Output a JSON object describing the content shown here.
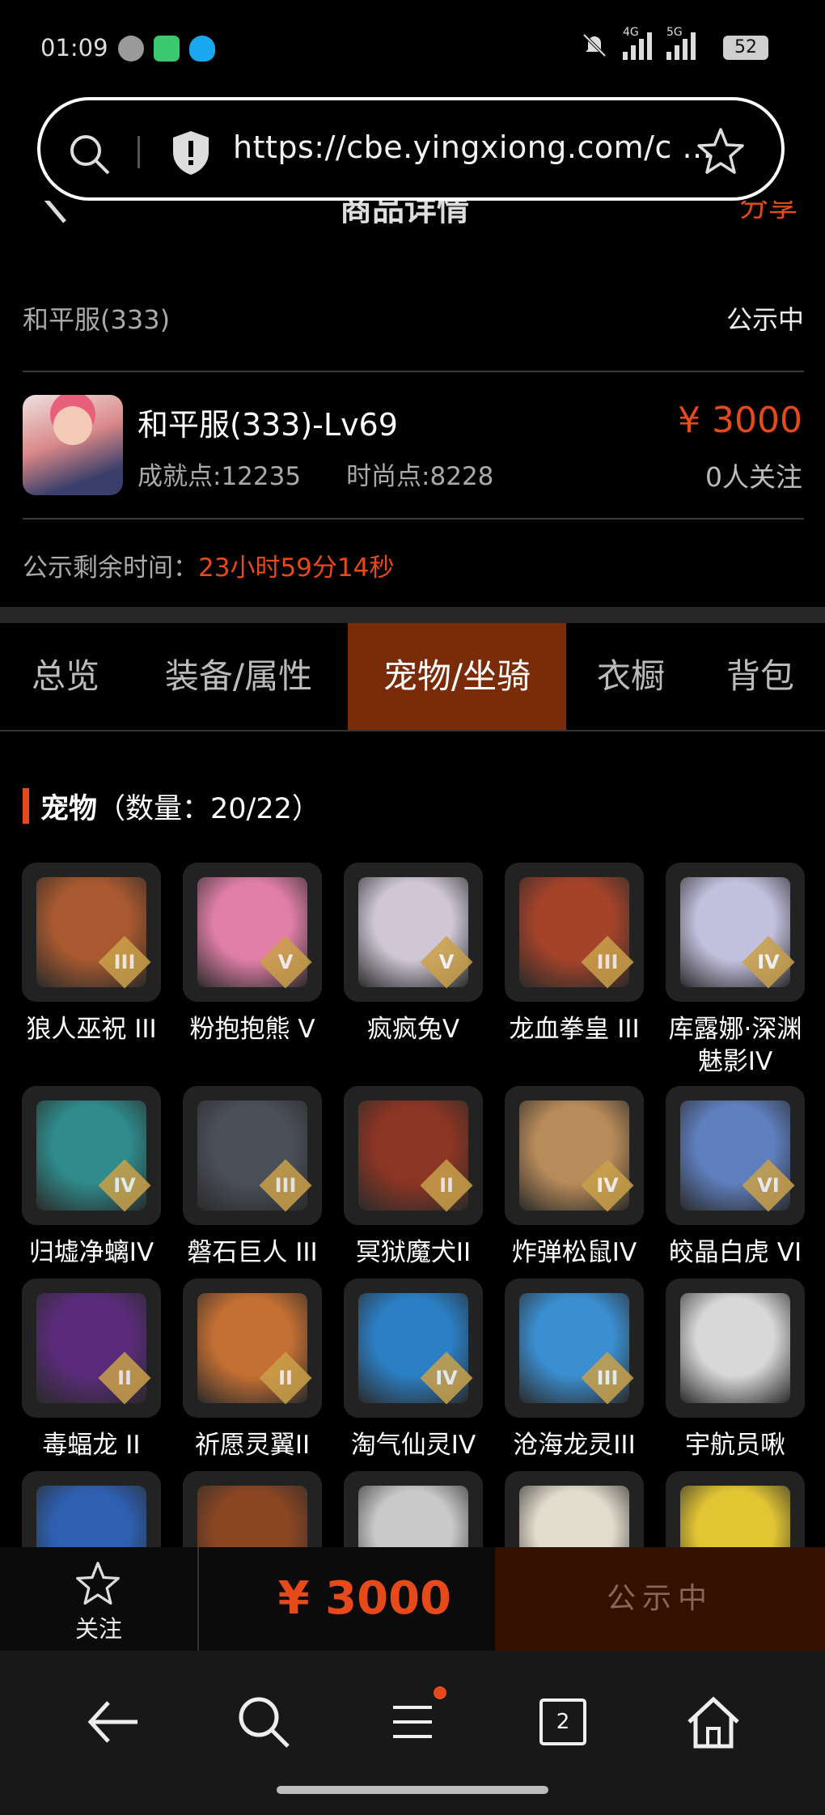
{
  "status_bar": {
    "time": "01:09",
    "net1": "4G",
    "net2": "5G",
    "battery": "52"
  },
  "browser": {
    "url": "https://cbe.yingxiong.com/c ..."
  },
  "header": {
    "title": "商品详情",
    "share": "分享"
  },
  "server": {
    "name": "和平服(333)",
    "status": "公示中"
  },
  "character": {
    "name": "和平服(333)-Lv69",
    "achievement": "成就点:12235",
    "fashion": "时尚点:8228",
    "price": "¥ 3000",
    "followers": "0人关注"
  },
  "remaining": {
    "label": "公示剩余时间：",
    "value": "23小时59分14秒"
  },
  "tabs": [
    "总览",
    "装备/属性",
    "宠物/坐骑",
    "衣橱",
    "背包"
  ],
  "active_tab": "宠物/坐骑",
  "section": {
    "title": "宠物",
    "count": "（数量：20/22）"
  },
  "pets": [
    {
      "name": "狼人巫祝 III",
      "tier": "III",
      "color": "#a8592f"
    },
    {
      "name": "粉抱抱熊 V",
      "tier": "V",
      "color": "#e07fa6"
    },
    {
      "name": "疯疯兔V",
      "tier": "V",
      "color": "#cfc7d6"
    },
    {
      "name": "龙血拳皇 III",
      "tier": "III",
      "color": "#a4432a"
    },
    {
      "name": "库露娜·深渊魅影IV",
      "tier": "IV",
      "color": "#c4c1df"
    },
    {
      "name": "归墟净螭IV",
      "tier": "IV",
      "color": "#2f8b8c"
    },
    {
      "name": "磐石巨人 III",
      "tier": "III",
      "color": "#4b4f59"
    },
    {
      "name": "冥狱魔犬II",
      "tier": "II",
      "color": "#8b3524"
    },
    {
      "name": "炸弹松鼠IV",
      "tier": "IV",
      "color": "#b88b5a"
    },
    {
      "name": "皎晶白虎 VI",
      "tier": "VI",
      "color": "#5f7fbf"
    },
    {
      "name": "毒蝠龙 II",
      "tier": "II",
      "color": "#5a2b7a"
    },
    {
      "name": "祈愿灵翼II",
      "tier": "II",
      "color": "#c46f33"
    },
    {
      "name": "淘气仙灵IV",
      "tier": "IV",
      "color": "#2b7fc4"
    },
    {
      "name": "沧海龙灵III",
      "tier": "III",
      "color": "#3b8fd1"
    },
    {
      "name": "宇航员啾",
      "tier": "",
      "color": "#d8d8d8"
    },
    {
      "name": "",
      "tier": "",
      "color": "#2e5fb0"
    },
    {
      "name": "",
      "tier": "",
      "color": "#8a4522"
    },
    {
      "name": "",
      "tier": "",
      "color": "#c9c9c9"
    },
    {
      "name": "",
      "tier": "",
      "color": "#e2dccd"
    },
    {
      "name": "",
      "tier": "",
      "color": "#e3c534"
    }
  ],
  "bottom": {
    "follow": "关注",
    "price": "¥ 3000",
    "status": "公示中"
  },
  "nav": {
    "tabs_count": "2"
  },
  "colors": {
    "accent": "#e64a1b",
    "active_tab_bg": "#7a2b08"
  }
}
